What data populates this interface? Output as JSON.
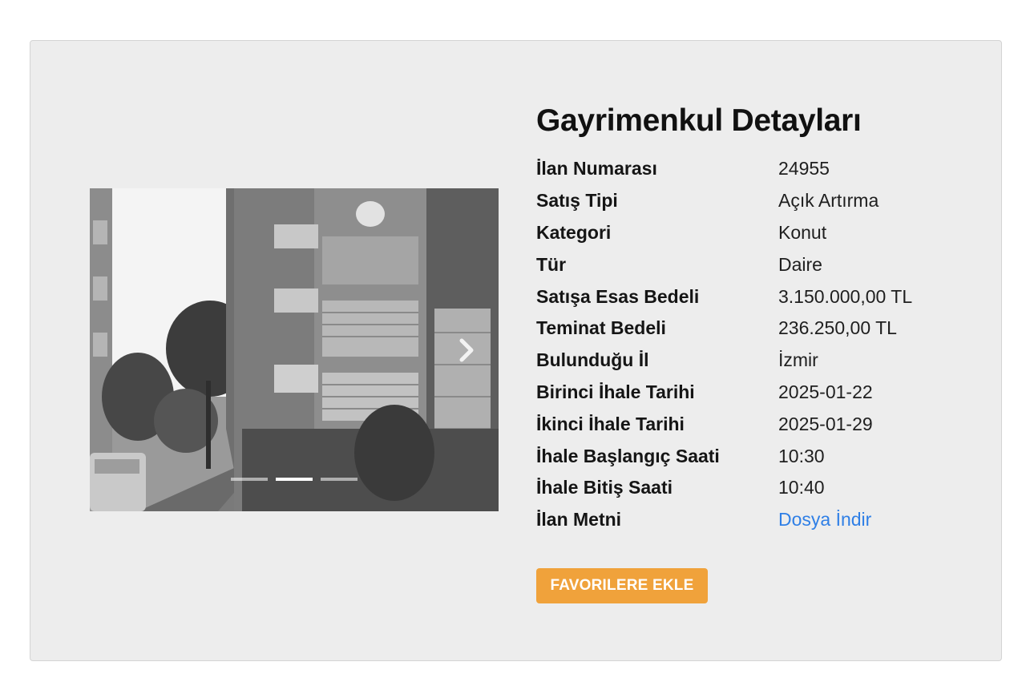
{
  "details": {
    "title": "Gayrimenkul Detayları",
    "rows": [
      {
        "label": "İlan Numarası",
        "value": "24955"
      },
      {
        "label": "Satış Tipi",
        "value": "Açık Artırma"
      },
      {
        "label": "Kategori",
        "value": "Konut"
      },
      {
        "label": "Tür",
        "value": "Daire"
      },
      {
        "label": "Satışa Esas Bedeli",
        "value": "3.150.000,00 TL"
      },
      {
        "label": "Teminat Bedeli",
        "value": "236.250,00 TL"
      },
      {
        "label": "Bulunduğu İl",
        "value": "İzmir"
      },
      {
        "label": "Birinci İhale Tarihi",
        "value": "2025-01-22"
      },
      {
        "label": "İkinci İhale Tarihi",
        "value": "2025-01-29"
      },
      {
        "label": "İhale Başlangıç Saati",
        "value": "10:30"
      },
      {
        "label": "İhale Bitiş Saati",
        "value": "10:40"
      },
      {
        "label": "İlan Metni",
        "value": "Dosya İndir"
      }
    ]
  },
  "actions": {
    "favorite_label": "FAVORILERE EKLE"
  },
  "carousel": {
    "slide_count": 3,
    "active_slide": 2,
    "next_icon": "chevron-right-icon"
  },
  "colors": {
    "card_background": "#ededed",
    "link": "#2f7fe6",
    "button": "#f0a23b"
  }
}
